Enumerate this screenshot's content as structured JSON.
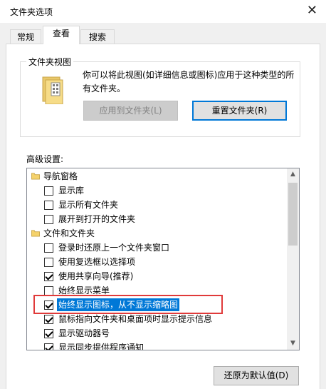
{
  "window": {
    "title": "文件夹选项",
    "close_glyph": "✕"
  },
  "tabs": [
    {
      "label": "常规",
      "active": false
    },
    {
      "label": "查看",
      "active": true
    },
    {
      "label": "搜索",
      "active": false
    }
  ],
  "folder_view": {
    "legend": "文件夹视图",
    "description": "你可以将此视图(如详细信息或图标)应用于这种类型的所有文件夹。",
    "apply_label": "应用到文件夹(L)",
    "reset_label": "重置文件夹(R)"
  },
  "advanced": {
    "label": "高级设置:",
    "items": [
      {
        "type": "folder",
        "text": "导航窗格"
      },
      {
        "type": "checkbox",
        "checked": false,
        "text": "显示库"
      },
      {
        "type": "checkbox",
        "checked": false,
        "text": "显示所有文件夹"
      },
      {
        "type": "checkbox",
        "checked": false,
        "text": "展开到打开的文件夹"
      },
      {
        "type": "folder",
        "text": "文件和文件夹"
      },
      {
        "type": "checkbox",
        "checked": false,
        "text": "登录时还原上一个文件夹窗口"
      },
      {
        "type": "checkbox",
        "checked": false,
        "text": "使用复选框以选择项"
      },
      {
        "type": "checkbox",
        "checked": true,
        "text": "使用共享向导(推荐)"
      },
      {
        "type": "checkbox",
        "checked": false,
        "text": "始终显示菜单"
      },
      {
        "type": "checkbox",
        "checked": true,
        "text": "始终显示图标，从不显示缩略图",
        "highlighted": true
      },
      {
        "type": "checkbox",
        "checked": true,
        "text": "鼠标指向文件夹和桌面项时显示提示信息"
      },
      {
        "type": "checkbox",
        "checked": true,
        "text": "显示驱动器号"
      },
      {
        "type": "checkbox",
        "checked": true,
        "text": "显示同步提供程序通知"
      }
    ]
  },
  "restore_label": "还原为默认值(D)",
  "colors": {
    "highlight": "#0078d7",
    "annotation_box": "#e03a3a"
  }
}
